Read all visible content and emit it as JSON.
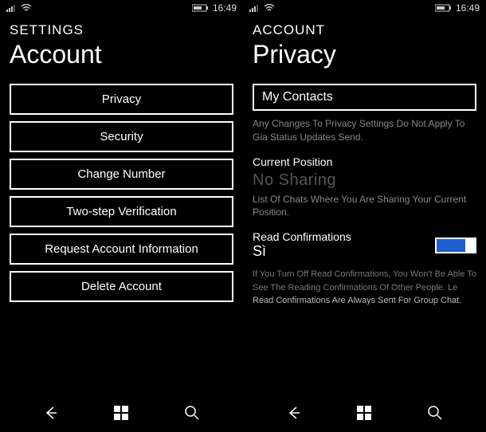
{
  "status": {
    "time": "16:49"
  },
  "left": {
    "breadcrumb": "SETTINGS",
    "title": "Account",
    "buttons": [
      "Privacy",
      "Security",
      "Change Number",
      "Two-step Verification",
      "Request Account Information",
      "Delete Account"
    ]
  },
  "right": {
    "breadcrumb": "ACCOUNT",
    "title": "Privacy",
    "select_value": "My Contacts",
    "select_hint": "Any Changes To Privacy Settings Do Not Apply To Gia Status Updates Send.",
    "position_label": "Current Position",
    "position_value": "No Sharing",
    "position_hint": "List Of Chats Where You Are Sharing Your Current Position.",
    "read_label": "Read Confirmations",
    "read_value": "Sì",
    "read_hint_1": "If You Turn Off Read Confirmations, You Won't Be Able To See The Reading Confirmations Of Other People. Le ",
    "read_hint_2": "Read Confirmations Are Always Sent For Group Chat."
  }
}
